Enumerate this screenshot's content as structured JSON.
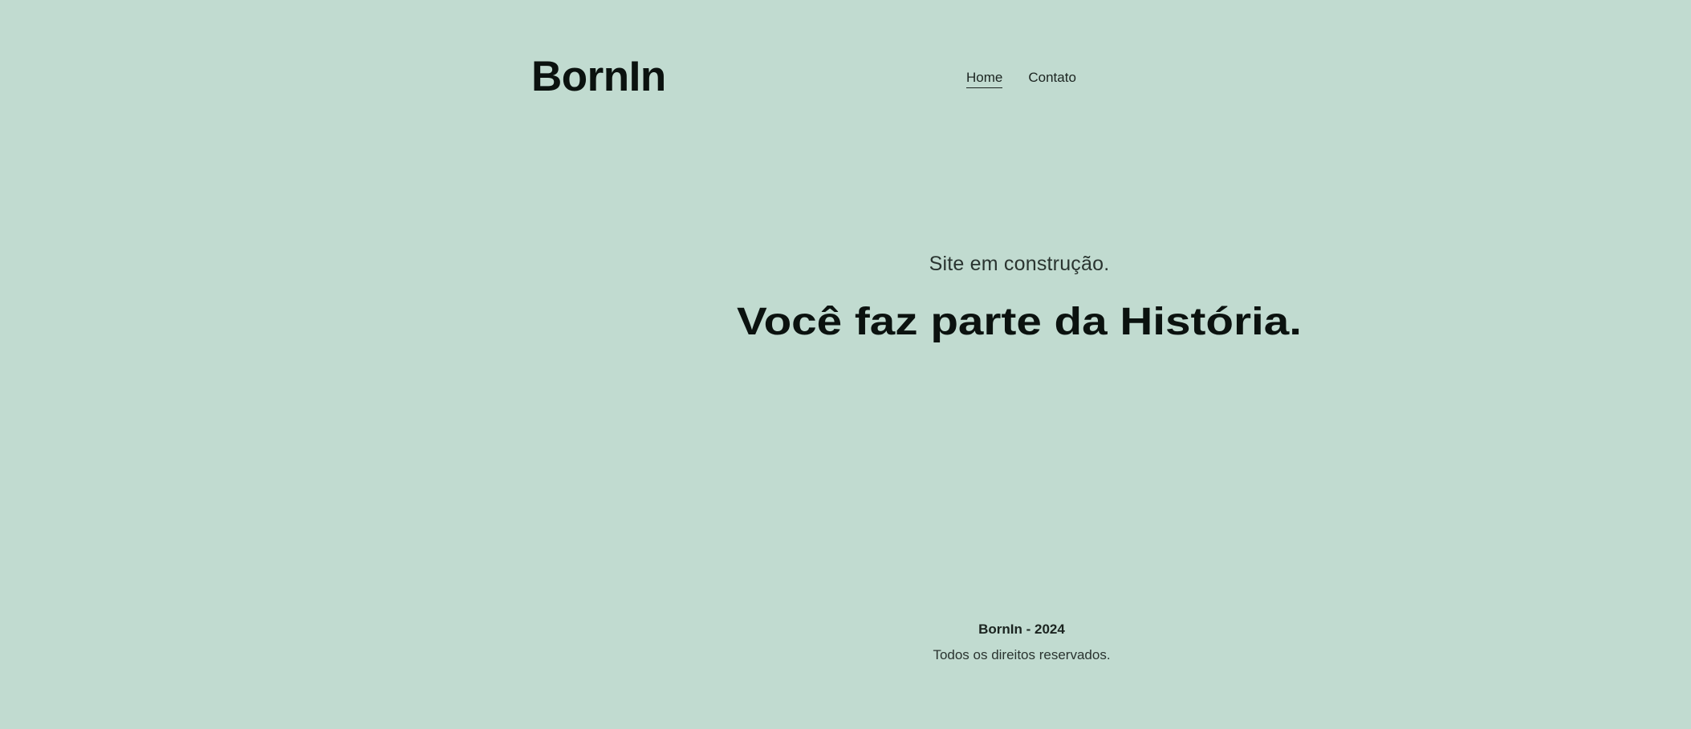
{
  "header": {
    "logo": "BornIn",
    "nav": [
      {
        "label": "Home",
        "active": true
      },
      {
        "label": "Contato",
        "active": false
      }
    ]
  },
  "hero": {
    "subtitle": "Site em construção.",
    "headline": "Você faz parte da História."
  },
  "footer": {
    "brand": "BornIn - 2024",
    "rights": "Todos os direitos reservados."
  },
  "colors": {
    "background": "#c1dbd0",
    "text": "#0b120f"
  }
}
